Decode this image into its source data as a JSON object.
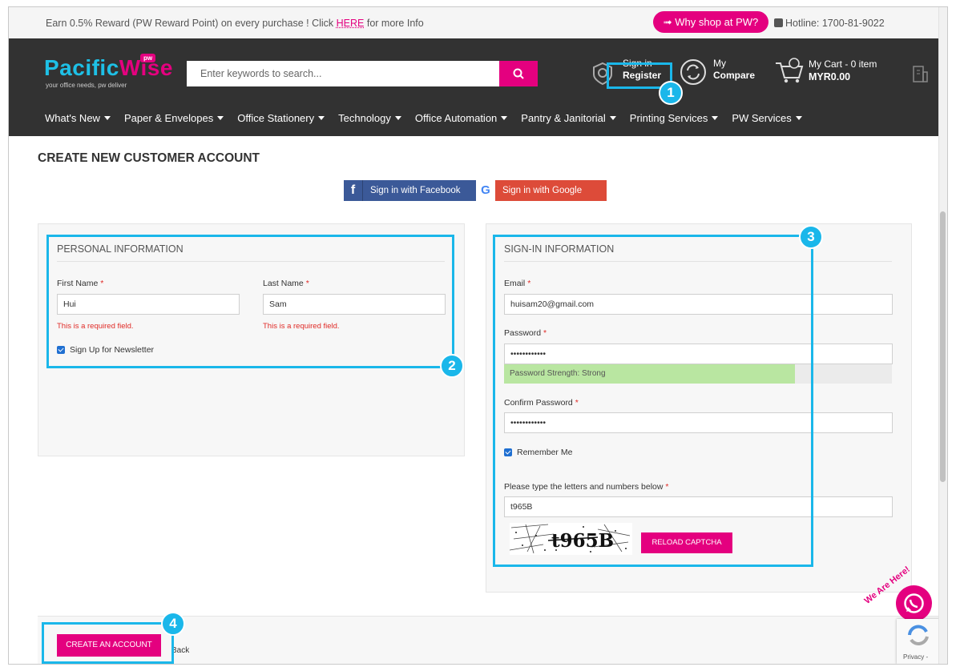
{
  "topbar": {
    "promo_prefix": "Earn 0.5% Reward (PW Reward Point) on every purchase ! Click ",
    "promo_link": "HERE",
    "promo_suffix": " for more Info",
    "why_button": "➟ Why shop at PW?",
    "hotline": "Hotline: 1700-81-9022"
  },
  "header": {
    "logo_word_1": "Pacific",
    "logo_word_2": "Wise",
    "logo_badge": "pw",
    "logo_tagline": "your office needs, pw deliver",
    "search_placeholder": "Enter keywords to search...",
    "signin_label": "Sign in",
    "register_label": "Register",
    "compare_line1": "My",
    "compare_line2": "Compare",
    "cart_line1": "My Cart - 0 item",
    "cart_line2": "MYR0.00"
  },
  "nav": {
    "items": [
      "What's New",
      "Paper & Envelopes",
      "Office Stationery",
      "Technology",
      "Office Automation",
      "Pantry & Janitorial",
      "Printing Services",
      "PW Services"
    ]
  },
  "page_title": "CREATE NEW CUSTOMER ACCOUNT",
  "social": {
    "facebook": "Sign in with Facebook",
    "google": "Sign in with Google"
  },
  "personal": {
    "legend": "PERSONAL INFORMATION",
    "first_name_label": "First Name",
    "first_name_value": "Hui",
    "first_name_error": "This is a required field.",
    "last_name_label": "Last Name",
    "last_name_value": "Sam",
    "last_name_error": "This is a required field.",
    "newsletter_label": "Sign Up for Newsletter"
  },
  "signin": {
    "legend": "SIGN-IN INFORMATION",
    "email_label": "Email",
    "email_value": "huisam20@gmail.com",
    "password_label": "Password",
    "password_value": "••••••••••••",
    "strength_text": "Password Strength: Strong",
    "strength_level": 0.75,
    "confirm_label": "Confirm Password",
    "confirm_value": "••••••••••••",
    "remember_label": "Remember Me",
    "captcha_label": "Please type the letters and numbers below",
    "captcha_value": "t965B",
    "captcha_image_text": "t965B",
    "reload_button": "RELOAD CAPTCHA"
  },
  "actions": {
    "create_button": "CREATE AN ACCOUNT",
    "back_link": "Back"
  },
  "annotations": [
    "1",
    "2",
    "3",
    "4"
  ],
  "widgets": {
    "whatsapp_text": "We Are Here!",
    "recaptcha_text": "Privacy -"
  },
  "required_mark": "*",
  "colors": {
    "brand_pink": "#e4007f",
    "brand_cyan": "#1ec0e6",
    "header_bg": "#323232",
    "annotation_blue": "#1ab7ea",
    "error_red": "#e02b27",
    "strength_green": "#b9e6a1"
  }
}
